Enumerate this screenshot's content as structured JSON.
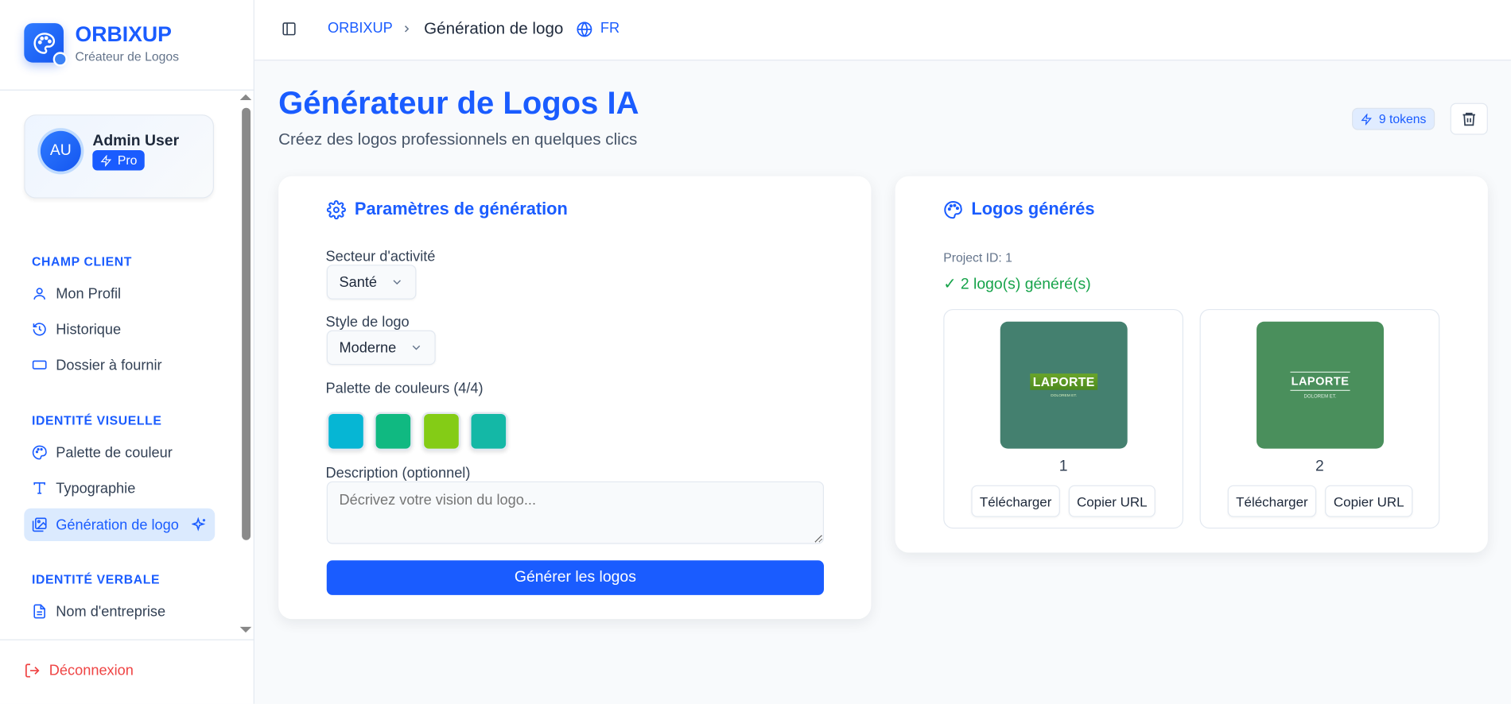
{
  "sidebar": {
    "brand": "ORBIXUP",
    "brand_subtitle": "Créateur de Logos",
    "user": {
      "initials": "AU",
      "name": "Admin User",
      "plan": "Pro"
    },
    "sections": [
      {
        "title": "CHAMP CLIENT",
        "items": [
          {
            "label": "Mon Profil",
            "icon": "user-icon"
          },
          {
            "label": "Historique",
            "icon": "history-icon"
          },
          {
            "label": "Dossier à fournir",
            "icon": "folder-icon"
          }
        ]
      },
      {
        "title": "IDENTITÉ VISUELLE",
        "items": [
          {
            "label": "Palette de couleur",
            "icon": "palette-icon"
          },
          {
            "label": "Typographie",
            "icon": "type-icon"
          },
          {
            "label": "Génération de logo",
            "icon": "image-icon",
            "active": true
          }
        ]
      },
      {
        "title": "IDENTITÉ VERBALE",
        "items": [
          {
            "label": "Nom d'entreprise",
            "icon": "file-text-icon"
          }
        ]
      }
    ],
    "logout": "Déconnexion"
  },
  "header": {
    "breadcrumb_root": "ORBIXUP",
    "breadcrumb_current": "Génération de logo",
    "language": "FR"
  },
  "page": {
    "title": "Générateur de Logos IA",
    "subtitle": "Créez des logos professionnels en quelques clics",
    "tokens": "9 tokens"
  },
  "params": {
    "heading": "Paramètres de génération",
    "sector_label": "Secteur d'activité",
    "sector_value": "Santé",
    "style_label": "Style de logo",
    "style_value": "Moderne",
    "palette_label": "Palette de couleurs (4/4)",
    "palette": [
      "#06b6d4",
      "#10b981",
      "#84cc16",
      "#14b8a6"
    ],
    "description_label": "Description (optionnel)",
    "description_placeholder": "Décrivez votre vision du logo...",
    "description_value": "",
    "generate_label": "Générer les logos"
  },
  "results": {
    "heading": "Logos générés",
    "project_id": "Project ID: 1",
    "status": "✓ 2 logo(s) généré(s)",
    "logos": [
      {
        "number": "1",
        "brand_text": "LAPORTE",
        "tagline": "DOLOREM ET.",
        "bg": "#44806f",
        "download": "Télécharger",
        "copy": "Copier URL"
      },
      {
        "number": "2",
        "brand_text": "LAPORTE",
        "tagline": "DOLOREM ET.",
        "bg": "#4a8f5c",
        "download": "Télécharger",
        "copy": "Copier URL"
      }
    ]
  },
  "colors": {
    "accent": "#1a5cff",
    "success": "#16a34a",
    "danger": "#ef4444"
  }
}
